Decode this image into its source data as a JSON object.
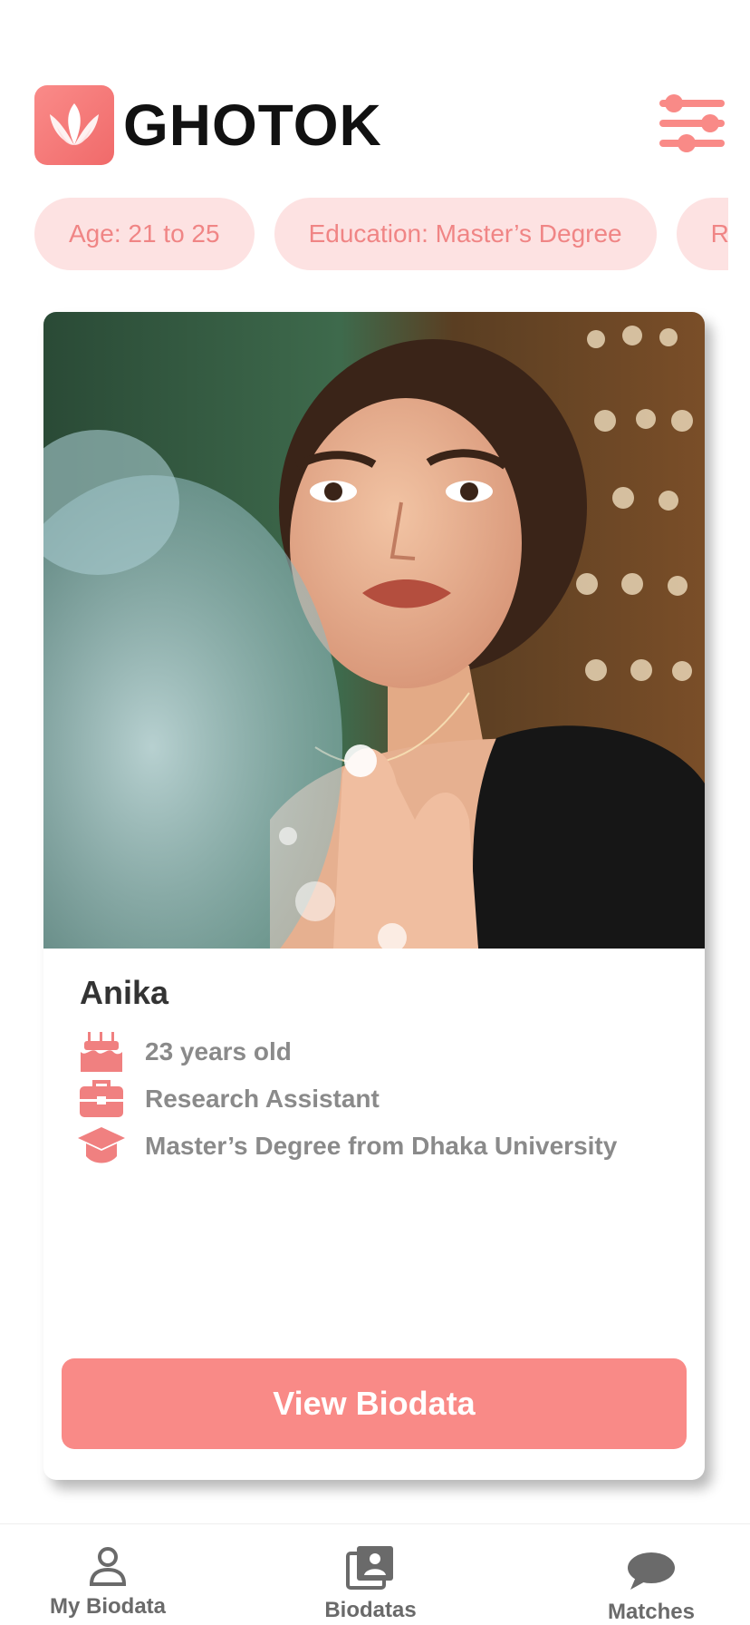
{
  "app": {
    "logo_icon": "lotus-icon",
    "title": "GHOTOK",
    "filter_icon": "sliders-icon"
  },
  "filters": {
    "chips": [
      "Age: 21 to 25",
      "Education: Master’s Degree",
      "Religion"
    ]
  },
  "profile": {
    "name": "Anika",
    "age_text": "23 years old",
    "occupation": "Research Assistant",
    "education": "Master’s Degree from Dhaka University",
    "age_icon": "birthday-cake-icon",
    "occupation_icon": "briefcase-icon",
    "education_icon": "graduation-cap-icon",
    "view_button_label": "View Biodata"
  },
  "nav": {
    "items": [
      {
        "label": "My Biodata",
        "icon": "user-icon"
      },
      {
        "label": "Biodatas",
        "icon": "profiles-icon"
      },
      {
        "label": "Matches",
        "icon": "chat-bubble-icon"
      }
    ]
  },
  "colors": {
    "accent": "#f98a87",
    "chip_bg": "#fde2e2",
    "chip_text": "#f08585",
    "icon": "#f08080"
  }
}
